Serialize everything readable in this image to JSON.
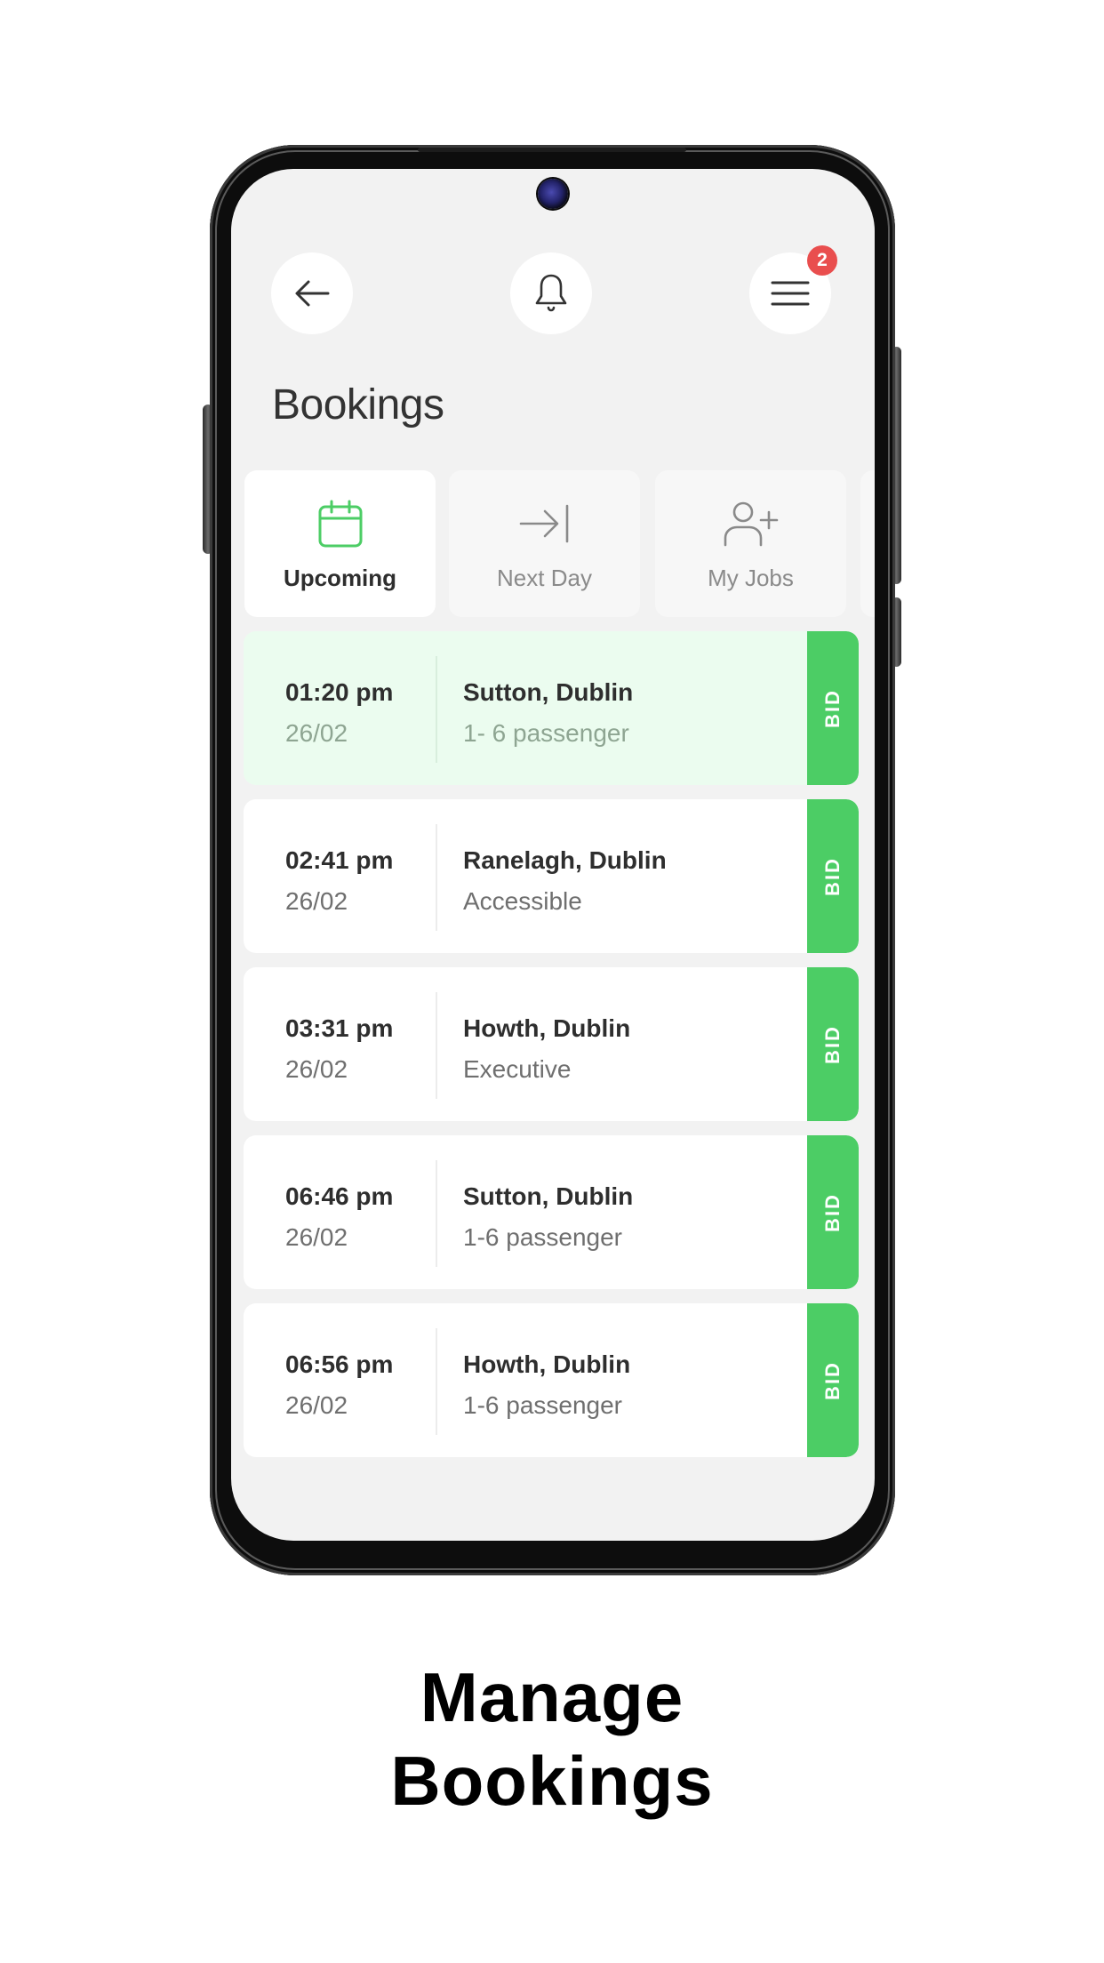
{
  "device": {
    "camera": "front-camera"
  },
  "header": {
    "back_icon": "arrow-left-icon",
    "notification_icon": "bell-icon",
    "menu_icon": "hamburger-menu-icon",
    "menu_badge_count": "2"
  },
  "page_title": "Bookings",
  "tabs": [
    {
      "label": "Upcoming",
      "icon": "calendar-icon",
      "active": true
    },
    {
      "label": "Next Day",
      "icon": "arrow-to-line-icon",
      "active": false
    },
    {
      "label": "My Jobs",
      "icon": "user-plus-icon",
      "active": false
    }
  ],
  "bookings": [
    {
      "time": "01:20 pm",
      "date": "26/02",
      "location": "Sutton, Dublin",
      "detail": "1- 6 passenger",
      "action": "BID",
      "highlighted": true
    },
    {
      "time": "02:41 pm",
      "date": "26/02",
      "location": "Ranelagh, Dublin",
      "detail": "Accessible",
      "action": "BID",
      "highlighted": false
    },
    {
      "time": "03:31 pm",
      "date": "26/02",
      "location": "Howth, Dublin",
      "detail": "Executive",
      "action": "BID",
      "highlighted": false
    },
    {
      "time": "06:46 pm",
      "date": "26/02",
      "location": "Sutton, Dublin",
      "detail": "1-6 passenger",
      "action": "BID",
      "highlighted": false
    },
    {
      "time": "06:56 pm",
      "date": "26/02",
      "location": "Howth, Dublin",
      "detail": "1-6 passenger",
      "action": "BID",
      "highlighted": false
    }
  ],
  "caption": {
    "line1": "Manage",
    "line2": "Bookings"
  },
  "colors": {
    "accent_green": "#4ccd65",
    "highlight_bg": "#ebfcef",
    "badge_red": "#e94e4e",
    "screen_bg": "#f2f2f2"
  }
}
